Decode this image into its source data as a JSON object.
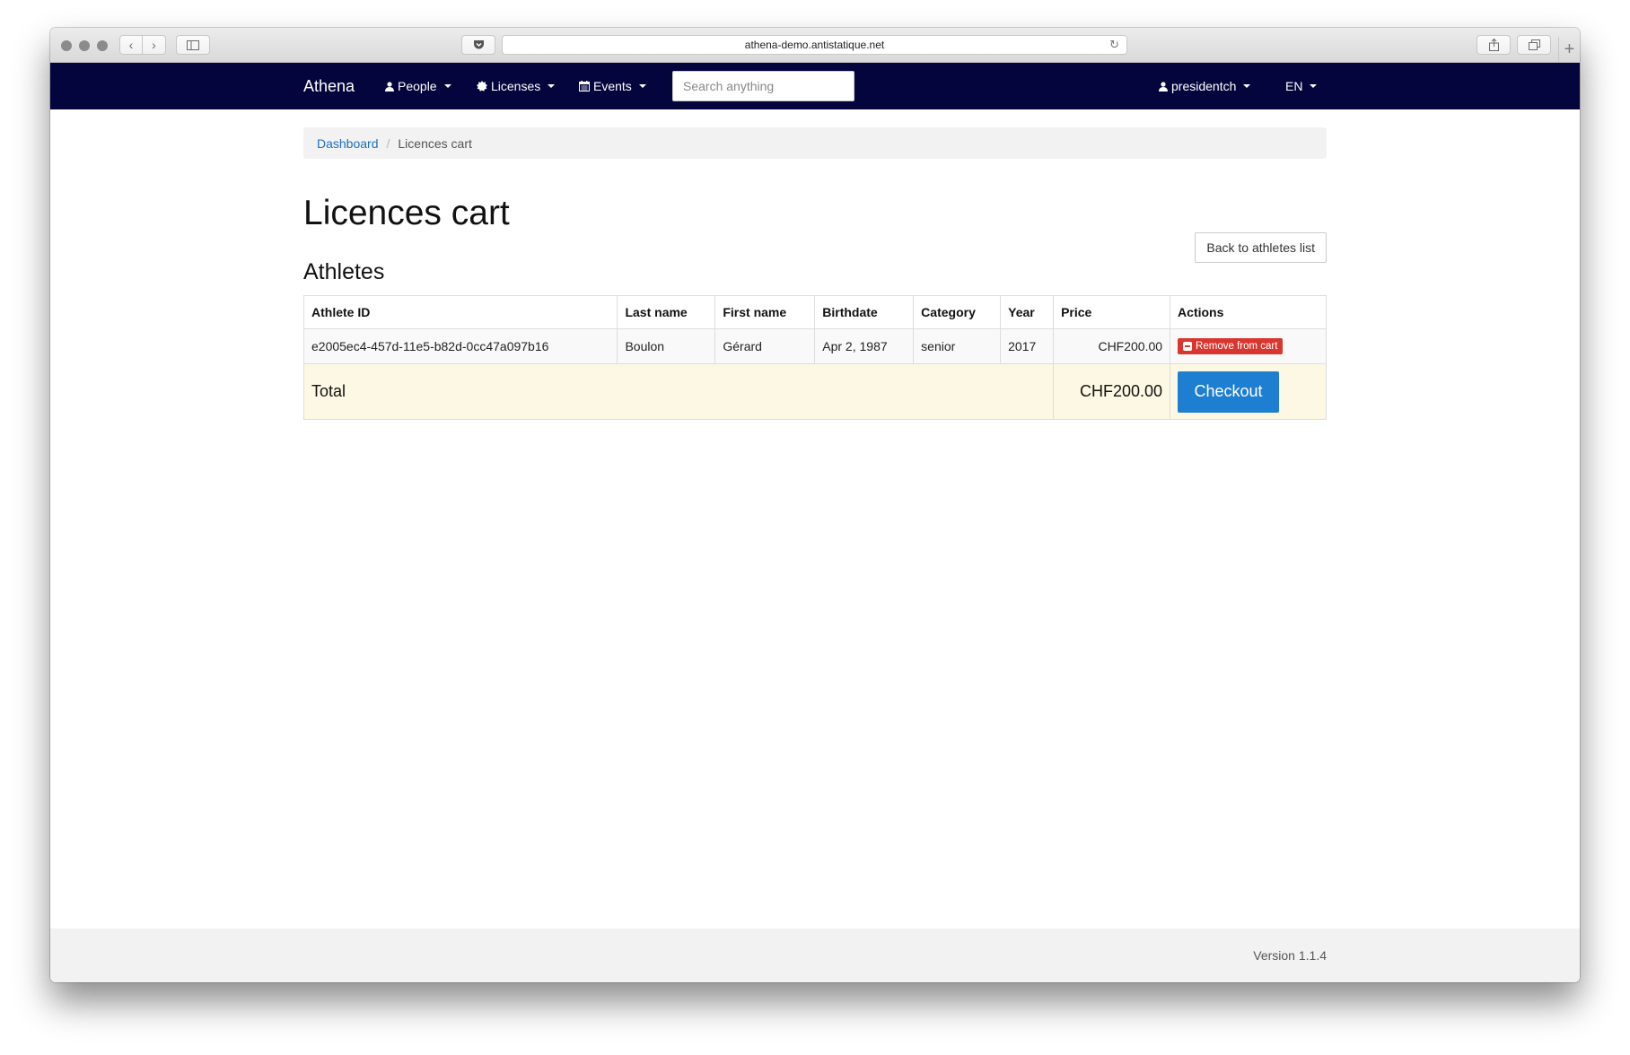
{
  "browser": {
    "url": "athena-demo.antistatique.net",
    "newtab_glyph": "+"
  },
  "navbar": {
    "brand": "Athena",
    "items": [
      {
        "label": "People",
        "icon": "user-icon"
      },
      {
        "label": "Licenses",
        "icon": "certificate-icon"
      },
      {
        "label": "Events",
        "icon": "calendar-icon"
      }
    ],
    "search_placeholder": "Search anything",
    "user": "presidentch",
    "language": "EN"
  },
  "breadcrumb": {
    "home": "Dashboard",
    "current": "Licences cart"
  },
  "page": {
    "title": "Licences cart",
    "section": "Athletes",
    "back_button": "Back to athletes list"
  },
  "table": {
    "headers": [
      "Athlete ID",
      "Last name",
      "First name",
      "Birthdate",
      "Category",
      "Year",
      "Price",
      "Actions"
    ],
    "rows": [
      {
        "athlete_id": "e2005ec4-457d-11e5-b82d-0cc47a097b16",
        "last_name": "Boulon",
        "first_name": "Gérard",
        "birthdate": "Apr 2, 1987",
        "category": "senior",
        "year": "2017",
        "price": "CHF200.00",
        "action": "Remove from cart"
      }
    ],
    "total_label": "Total",
    "total_price": "CHF200.00",
    "checkout": "Checkout"
  },
  "footer": {
    "version": "Version 1.1.4"
  },
  "colors": {
    "navbar": "#05053d",
    "link": "#1f6fbd",
    "danger": "#d9362f",
    "primary": "#1e7ed1",
    "total_row": "#fcf8e3"
  }
}
